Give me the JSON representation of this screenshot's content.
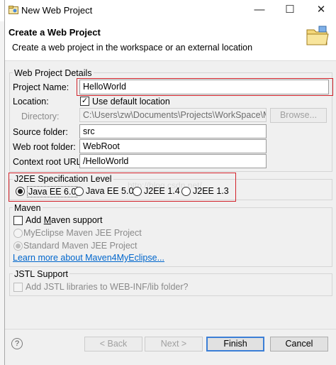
{
  "window": {
    "title": "New Web Project",
    "controls": {
      "minimize": "—",
      "maximize": "☐",
      "close": "✕"
    }
  },
  "header": {
    "title": "Create a Web Project",
    "description": "Create a web project in the workspace or an external location"
  },
  "details": {
    "group_label": "Web Project Details",
    "project_name_label": "Project Name:",
    "project_name_value": "HelloWorld",
    "location_label": "Location:",
    "use_default_label": "Use default location",
    "use_default_checked": true,
    "directory_label": "Directory:",
    "directory_value": "C:\\Users\\zw\\Documents\\Projects\\WorkSpace\\MyE",
    "browse_label": "Browse...",
    "source_folder_label": "Source folder:",
    "source_folder_value": "src",
    "web_root_label": "Web root folder:",
    "web_root_value": "WebRoot",
    "context_root_label": "Context root URL:",
    "context_root_value": "/HelloWorld"
  },
  "j2ee": {
    "group_label": "J2EE Specification Level",
    "options": [
      "Java EE 6.0",
      "Java EE 5.0",
      "J2EE 1.4",
      "J2EE 1.3"
    ],
    "selected": "Java EE 6.0"
  },
  "maven": {
    "group_label": "Maven",
    "add_support_prefix": "Add ",
    "add_support_mnemonic": "M",
    "add_support_suffix": "aven support",
    "option_myeclipse": "MyEclipse Maven JEE Project",
    "option_standard": "Standard Maven JEE Project",
    "learn_more": "Learn more about Maven4MyEclipse..."
  },
  "jstl": {
    "group_label": "JSTL Support",
    "add_jstl_label": "Add JSTL libraries to WEB-INF/lib folder?"
  },
  "footer": {
    "help": "?",
    "back_label": "< Back",
    "next_label": "Next >",
    "finish_label": "Finish",
    "cancel_label": "Cancel"
  },
  "colors": {
    "highlight": "#d2222a",
    "link": "#0066cc",
    "default_button": "#3c7fd6"
  }
}
